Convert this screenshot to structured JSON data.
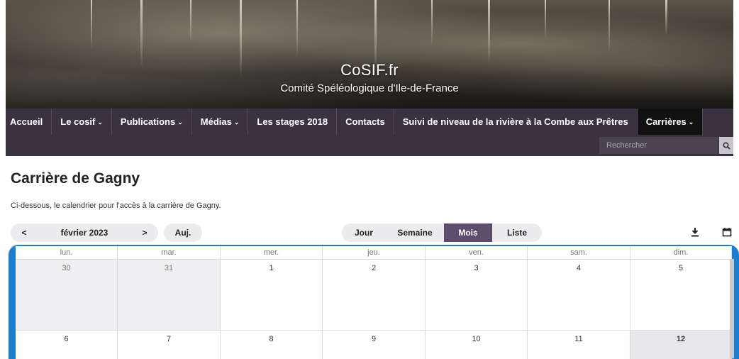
{
  "site": {
    "title": "CoSIF.fr",
    "subtitle": "Comité Spéléologique d'Ile-de-France"
  },
  "nav": {
    "items": [
      {
        "label": "Accueil",
        "has_submenu": false
      },
      {
        "label": "Le cosif",
        "has_submenu": true
      },
      {
        "label": "Publications",
        "has_submenu": true
      },
      {
        "label": "Médias",
        "has_submenu": true
      },
      {
        "label": "Les stages 2018",
        "has_submenu": false
      },
      {
        "label": "Contacts",
        "has_submenu": false
      },
      {
        "label": "Suivi de niveau de la rivière à la Combe aux Prêtres",
        "has_submenu": false
      },
      {
        "label": "Carrières",
        "has_submenu": true,
        "active": true
      }
    ],
    "caret": "⌄"
  },
  "search": {
    "placeholder": "Rechercher",
    "icon": "search-icon"
  },
  "page": {
    "title": "Carrière de Gagny",
    "intro": "Ci-dessous, le calendrier pour l'accès à la carrière de Gagny."
  },
  "calendar": {
    "prev_label": "<",
    "month_label": "février 2023",
    "next_label": ">",
    "today_label": "Auj.",
    "views": [
      "Jour",
      "Semaine",
      "Mois",
      "Liste"
    ],
    "active_view": "Mois",
    "download_icon": "download-icon",
    "calendar_icon": "calendar-icon",
    "weekdays": [
      "lun.",
      "mar.",
      "mer.",
      "jeu.",
      "ven.",
      "sam.",
      "dim."
    ],
    "weeks": [
      [
        {
          "d": "30",
          "other": true
        },
        {
          "d": "31",
          "other": true
        },
        {
          "d": "1"
        },
        {
          "d": "2"
        },
        {
          "d": "3"
        },
        {
          "d": "4"
        },
        {
          "d": "5"
        }
      ],
      [
        {
          "d": "6"
        },
        {
          "d": "7"
        },
        {
          "d": "8"
        },
        {
          "d": "9"
        },
        {
          "d": "10"
        },
        {
          "d": "11"
        },
        {
          "d": "12",
          "today": true
        }
      ]
    ]
  }
}
